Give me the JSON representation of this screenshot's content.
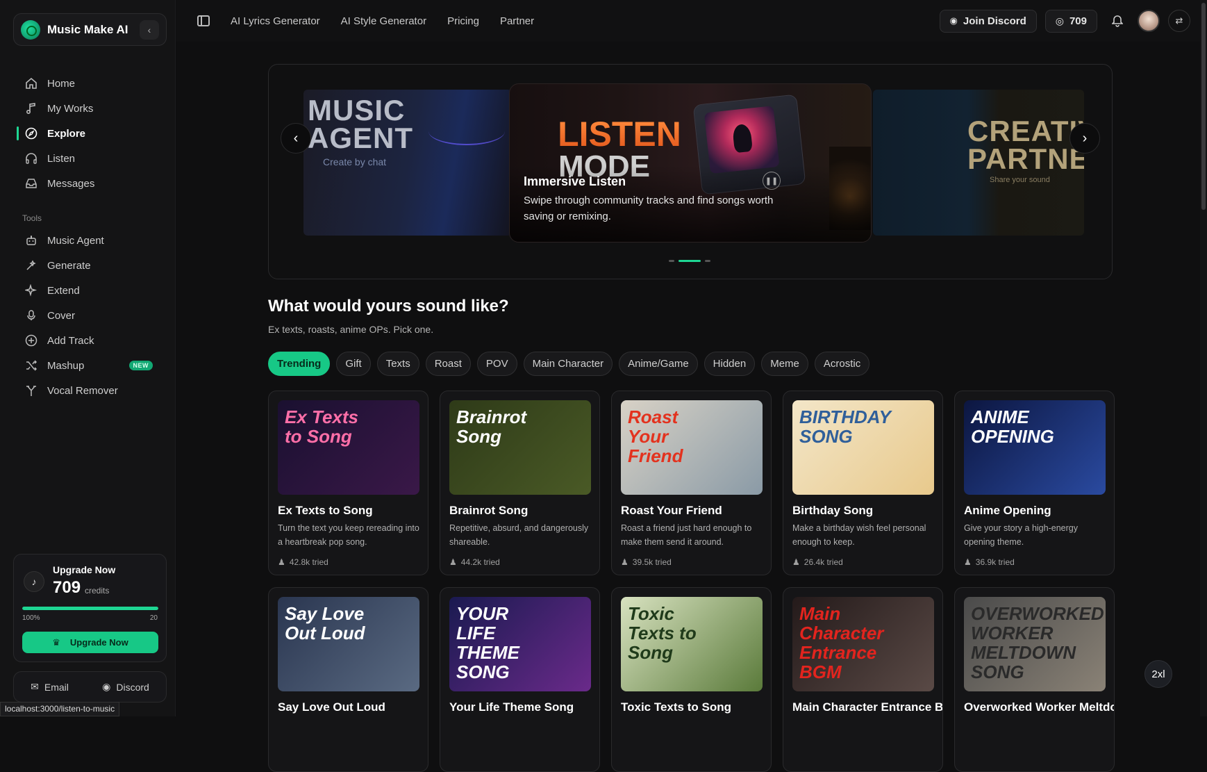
{
  "brand": {
    "name": "Music Make AI"
  },
  "nav": {
    "main": [
      {
        "label": "Home",
        "icon": "home-icon"
      },
      {
        "label": "My Works",
        "icon": "music-note-icon"
      },
      {
        "label": "Explore",
        "icon": "compass-icon",
        "active": true
      },
      {
        "label": "Listen",
        "icon": "headphones-icon"
      },
      {
        "label": "Messages",
        "icon": "inbox-icon"
      }
    ],
    "tools_label": "Tools",
    "tools": [
      {
        "label": "Music Agent",
        "icon": "robot-icon"
      },
      {
        "label": "Generate",
        "icon": "wand-icon"
      },
      {
        "label": "Extend",
        "icon": "sparkle-icon"
      },
      {
        "label": "Cover",
        "icon": "microphone-icon"
      },
      {
        "label": "Add Track",
        "icon": "plus-circle-icon"
      },
      {
        "label": "Mashup",
        "icon": "shuffle-icon",
        "badge": "NEW"
      },
      {
        "label": "Vocal Remover",
        "icon": "split-icon"
      }
    ]
  },
  "upgrade": {
    "title": "Upgrade Now",
    "credits": "709",
    "credits_label": "credits",
    "progress_percent": 100,
    "progress_left": "100%",
    "progress_right": "20",
    "button": "Upgrade Now"
  },
  "footer": {
    "email": "Email",
    "discord": "Discord"
  },
  "status_url": "localhost:3000/listen-to-music",
  "topbar": {
    "links": [
      "AI Lyrics Generator",
      "AI Style Generator",
      "Pricing",
      "Partner"
    ],
    "join_discord": "Join Discord",
    "credits": "709"
  },
  "hero": {
    "left_title": "MUSIC AGENT",
    "left_sub": "Create by chat",
    "main_title_1": "LISTEN",
    "main_title_2": "MODE",
    "main_caption_title": "Immersive Listen",
    "main_caption_text": "Swipe through community tracks and find songs worth saving or remixing.",
    "right_title": "CREATIVE PARTNER",
    "right_sub": "Share your sound"
  },
  "section": {
    "title": "What would yours sound like?",
    "subtitle": "Ex texts, roasts, anime OPs. Pick one."
  },
  "chips": [
    "Trending",
    "Gift",
    "Texts",
    "Roast",
    "POV",
    "Main Character",
    "Anime/Game",
    "Hidden",
    "Meme",
    "Acrostic"
  ],
  "cards": [
    {
      "title": "Ex Texts to Song",
      "desc": "Turn the text you keep rereading into a heartbreak pop song.",
      "tried": "42.8k tried",
      "art": "Ex Texts to Song",
      "c1": "#1a1030",
      "c2": "#3a1848",
      "tc": "#ff6fa8"
    },
    {
      "title": "Brainrot Song",
      "desc": "Repetitive, absurd, and dangerously shareable.",
      "tried": "44.2k tried",
      "art": "Brainrot Song",
      "c1": "#2e3a18",
      "c2": "#4a5a26",
      "tc": "#ffffff"
    },
    {
      "title": "Roast Your Friend",
      "desc": "Roast a friend just hard enough to make them send it around.",
      "tried": "39.5k tried",
      "art": "Roast Your Friend",
      "c1": "#d8d2c6",
      "c2": "#8a9aa6",
      "tc": "#e3321e"
    },
    {
      "title": "Birthday Song",
      "desc": "Make a birthday wish feel personal enough to keep.",
      "tried": "26.4k tried",
      "art": "BIRTHDAY SONG",
      "c1": "#f3e6c8",
      "c2": "#e8c98c",
      "tc": "#2f5f9a"
    },
    {
      "title": "Anime Opening",
      "desc": "Give your story a high-energy opening theme.",
      "tried": "36.9k tried",
      "art": "ANIME OPENING",
      "c1": "#0c1640",
      "c2": "#2a4aa0",
      "tc": "#ffffff"
    },
    {
      "title": "Say Love Out Loud",
      "desc": "",
      "tried": "",
      "art": "Say Love Out Loud",
      "c1": "#2a3650",
      "c2": "#5a6a82",
      "tc": "#ffffff"
    },
    {
      "title": "Your Life Theme Song",
      "desc": "",
      "tried": "",
      "art": "YOUR LIFE THEME SONG",
      "c1": "#1a1a50",
      "c2": "#6a2a8a",
      "tc": "#ffffff"
    },
    {
      "title": "Toxic Texts to Song",
      "desc": "",
      "tried": "",
      "art": "Toxic Texts to Song",
      "c1": "#d8e2c0",
      "c2": "#5a7a3a",
      "tc": "#1f3a1a"
    },
    {
      "title": "Main Character Entrance BGM",
      "desc": "",
      "tried": "",
      "art": "Main Character Entrance BGM",
      "c1": "#241a1a",
      "c2": "#5a4a46",
      "tc": "#e3241e"
    },
    {
      "title": "Overworked Worker Meltdown Song",
      "desc": "",
      "tried": "",
      "art": "OVERWORKED WORKER MELTDOWN SONG",
      "c1": "#4a4a4a",
      "c2": "#8a8276",
      "tc": "#2a2a2a"
    }
  ],
  "fab": "2xl"
}
